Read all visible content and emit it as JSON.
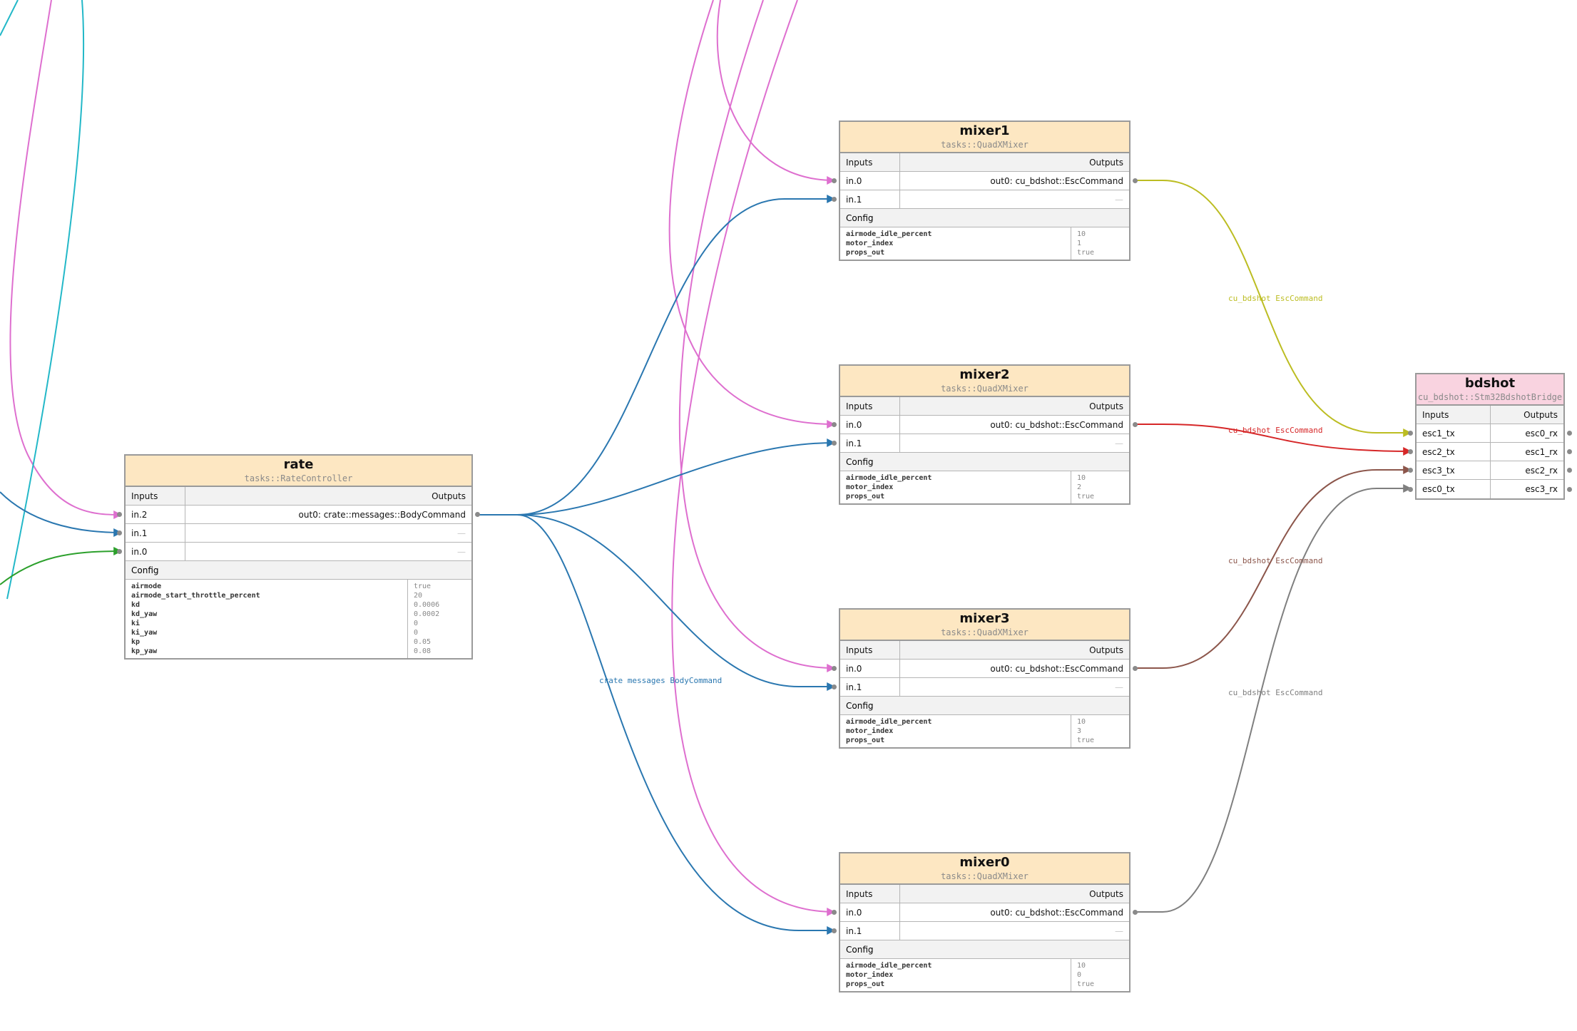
{
  "nodes": {
    "rate": {
      "name": "rate",
      "type": "tasks::RateController",
      "inputs_label": "Inputs",
      "outputs_label": "Outputs",
      "config_label": "Config",
      "inputs": [
        "in.2",
        "in.1",
        "in.0"
      ],
      "outputs": [
        "out0: crate::messages::BodyCommand",
        "—",
        "—"
      ],
      "config_keys": [
        "airmode",
        "airmode_start_throttle_percent",
        "kd",
        "kd_yaw",
        "ki",
        "ki_yaw",
        "kp",
        "kp_yaw"
      ],
      "config_values": [
        "true",
        "20",
        "0.0006",
        "0.0002",
        "0",
        "0",
        "0.05",
        "0.08"
      ]
    },
    "mixer1": {
      "name": "mixer1",
      "type": "tasks::QuadXMixer",
      "inputs_label": "Inputs",
      "outputs_label": "Outputs",
      "config_label": "Config",
      "inputs": [
        "in.0",
        "in.1"
      ],
      "outputs": [
        "out0: cu_bdshot::EscCommand",
        "—"
      ],
      "config_keys": [
        "airmode_idle_percent",
        "motor_index",
        "props_out"
      ],
      "config_values": [
        "10",
        "1",
        "true"
      ]
    },
    "mixer2": {
      "name": "mixer2",
      "type": "tasks::QuadXMixer",
      "inputs_label": "Inputs",
      "outputs_label": "Outputs",
      "config_label": "Config",
      "inputs": [
        "in.0",
        "in.1"
      ],
      "outputs": [
        "out0: cu_bdshot::EscCommand",
        "—"
      ],
      "config_keys": [
        "airmode_idle_percent",
        "motor_index",
        "props_out"
      ],
      "config_values": [
        "10",
        "2",
        "true"
      ]
    },
    "mixer3": {
      "name": "mixer3",
      "type": "tasks::QuadXMixer",
      "inputs_label": "Inputs",
      "outputs_label": "Outputs",
      "config_label": "Config",
      "inputs": [
        "in.0",
        "in.1"
      ],
      "outputs": [
        "out0: cu_bdshot::EscCommand",
        "—"
      ],
      "config_keys": [
        "airmode_idle_percent",
        "motor_index",
        "props_out"
      ],
      "config_values": [
        "10",
        "3",
        "true"
      ]
    },
    "mixer0": {
      "name": "mixer0",
      "type": "tasks::QuadXMixer",
      "inputs_label": "Inputs",
      "outputs_label": "Outputs",
      "config_label": "Config",
      "inputs": [
        "in.0",
        "in.1"
      ],
      "outputs": [
        "out0: cu_bdshot::EscCommand",
        "—"
      ],
      "config_keys": [
        "airmode_idle_percent",
        "motor_index",
        "props_out"
      ],
      "config_values": [
        "10",
        "0",
        "true"
      ]
    },
    "bdshot": {
      "name": "bdshot",
      "type": "cu_bdshot::Stm32BdshotBridge",
      "inputs_label": "Inputs",
      "outputs_label": "Outputs",
      "inputs": [
        "esc1_tx",
        "esc2_tx",
        "esc3_tx",
        "esc0_tx"
      ],
      "outputs": [
        "esc0_rx",
        "esc1_rx",
        "esc2_rx",
        "esc3_rx"
      ]
    }
  },
  "edge_labels": {
    "body_command": "crate messages BodyCommand",
    "esc_mixer1": "cu_bdshot EscCommand",
    "esc_mixer2": "cu_bdshot EscCommand",
    "esc_mixer3": "cu_bdshot EscCommand",
    "esc_mixer0": "cu_bdshot EscCommand"
  },
  "colors": {
    "body_command": "#2a77b0",
    "pink_input": "#de6fcf",
    "cyan_input": "#23b8c8",
    "green_input": "#2ca02c",
    "esc_mixer1": "#bcbd22",
    "esc_mixer2": "#d62728",
    "esc_mixer3": "#8c564b",
    "esc_mixer0": "#7f7f7f",
    "task_header": "#fde7c2",
    "bridge_header": "#f9d3e0"
  }
}
